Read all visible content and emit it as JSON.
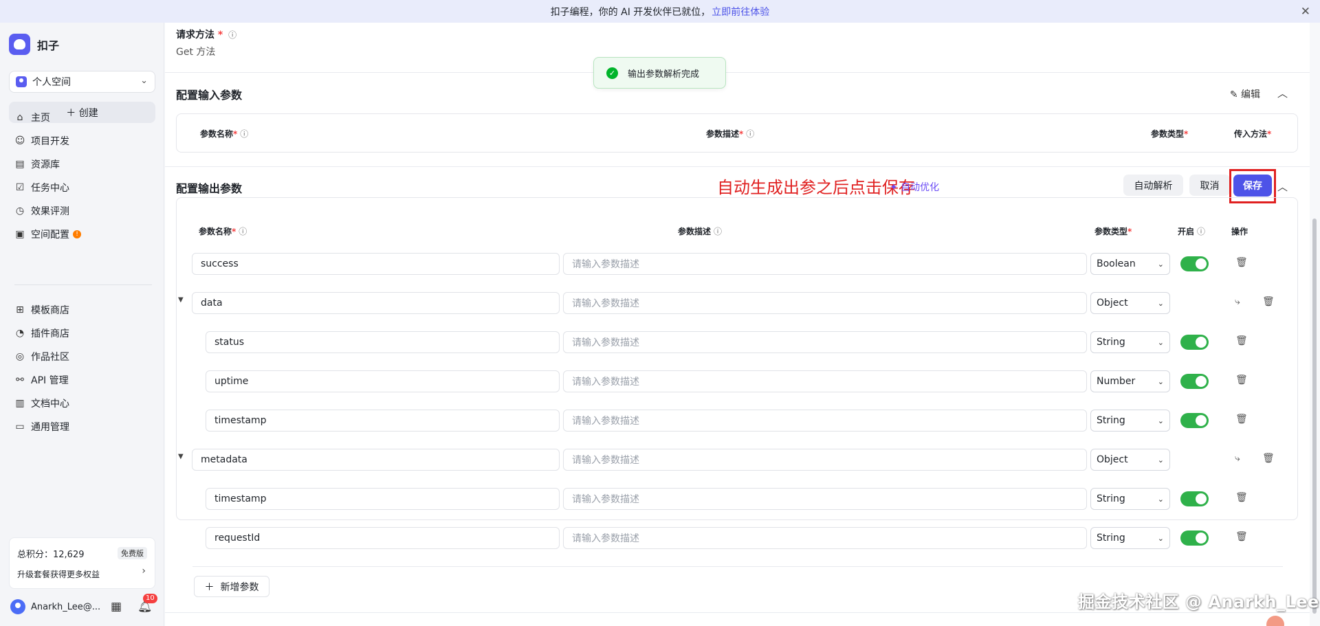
{
  "banner": {
    "text": "扣子编程，你的 AI 开发伙伴已就位，",
    "link": "立即前往体验",
    "close_icon": "✕"
  },
  "sidebar": {
    "brand": "扣子",
    "space": "个人空间",
    "create": "＋ 创建",
    "nav_main": [
      {
        "icon": "⌂",
        "label": "主页"
      },
      {
        "icon": "☺",
        "label": "项目开发"
      },
      {
        "icon": "▤",
        "label": "资源库"
      },
      {
        "icon": "☑",
        "label": "任务中心"
      },
      {
        "icon": "◷",
        "label": "效果评测"
      },
      {
        "icon": "▣",
        "label": "空间配置",
        "badge": "!"
      }
    ],
    "nav_secondary": [
      {
        "icon": "⊞",
        "label": "模板商店"
      },
      {
        "icon": "◔",
        "label": "插件商店"
      },
      {
        "icon": "◎",
        "label": "作品社区"
      },
      {
        "icon": "⚯",
        "label": "API 管理"
      },
      {
        "icon": "▥",
        "label": "文档中心"
      },
      {
        "icon": "▭",
        "label": "通用管理"
      }
    ],
    "points_label": "总积分：12,629",
    "plan_badge": "免费版",
    "upgrade": "升级套餐获得更多权益",
    "username": "Anarkh_Lee@...",
    "notifications": "10"
  },
  "main": {
    "request_label": "请求方法",
    "request_value": "Get 方法",
    "toast": "输出参数解析完成",
    "input_section": {
      "title": "配置输入参数",
      "edit": "编辑",
      "headers": {
        "name": "参数名称",
        "desc": "参数描述",
        "type": "参数类型",
        "method": "传入方法"
      }
    },
    "output_section": {
      "title": "配置输出参数",
      "annotation": "自动生成出参之后点击保存",
      "ai_optimize": "✦ 自动优化",
      "auto_parse": "自动解析",
      "cancel": "取消",
      "save": "保存",
      "headers": {
        "name": "参数名称",
        "desc": "参数描述",
        "type": "参数类型",
        "enable": "开启",
        "ops": "操作"
      },
      "desc_placeholder": "请输入参数描述",
      "rows": [
        {
          "name": "success",
          "type": "Boolean",
          "enabled": true,
          "level": 0,
          "expandable": false
        },
        {
          "name": "data",
          "type": "Object",
          "enabled": null,
          "level": 0,
          "expandable": true
        },
        {
          "name": "status",
          "type": "String",
          "enabled": true,
          "level": 1,
          "expandable": false
        },
        {
          "name": "uptime",
          "type": "Number",
          "enabled": true,
          "level": 1,
          "expandable": false
        },
        {
          "name": "timestamp",
          "type": "String",
          "enabled": true,
          "level": 1,
          "expandable": false
        },
        {
          "name": "metadata",
          "type": "Object",
          "enabled": null,
          "level": 0,
          "expandable": true
        },
        {
          "name": "timestamp",
          "type": "String",
          "enabled": true,
          "level": 1,
          "expandable": false
        },
        {
          "name": "requestId",
          "type": "String",
          "enabled": true,
          "level": 1,
          "expandable": false
        }
      ],
      "add_param": "新增参数"
    }
  },
  "watermark": "掘金技术社区 @ Anarkh_Lee"
}
